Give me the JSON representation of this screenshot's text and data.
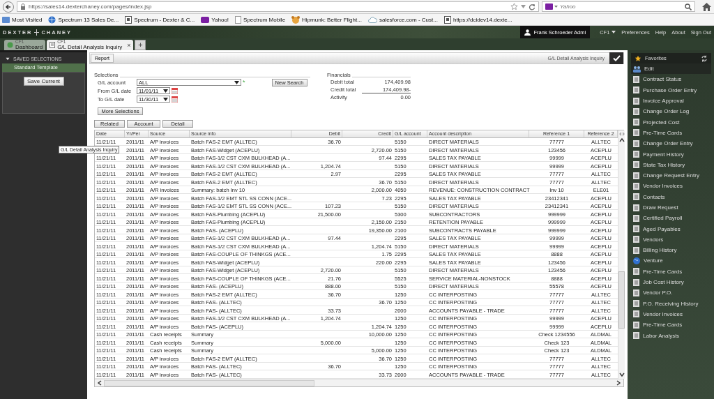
{
  "browser": {
    "url": "https://sales14.dexterchaney.com/pages/index.jsp",
    "search": {
      "placeholder": "Yahoo"
    }
  },
  "bookmarks": [
    {
      "label": "Most Visited",
      "kind": "folder"
    },
    {
      "label": "Spectrum 13 Sales De...",
      "kind": "globe"
    },
    {
      "label": "Spectrum - Dexter & C...",
      "kind": "page"
    },
    {
      "label": "Yahoo!",
      "kind": "yahoo"
    },
    {
      "label": "Spectrum Mobile",
      "kind": "blank"
    },
    {
      "label": "Hipmunk: Better Flight...",
      "kind": "animal"
    },
    {
      "label": "salesforce.com - Cust...",
      "kind": "cloud"
    },
    {
      "label": "https://dcidev14.dexte...",
      "kind": "page"
    }
  ],
  "app": {
    "logo": [
      "DEXTER",
      "CHANEY"
    ],
    "user": "Frank Schroeder Admi",
    "company": "CF1",
    "links": [
      "Preferences",
      "Help",
      "About",
      "Sign Out"
    ]
  },
  "tabs": [
    {
      "label": "Dashboard",
      "company": "CF1",
      "kind": "globe",
      "selected": false
    },
    {
      "label": "G/L Detail Analysis Inquiry",
      "company": "CF1",
      "kind": "doc",
      "selected": true,
      "close": "×"
    }
  ],
  "add_tab": "+",
  "saved_selections": {
    "title": "SAVED SELECTIONS",
    "expanded": true,
    "items": [
      {
        "label": "Standard Template",
        "selected": true
      }
    ],
    "button": "Save Current"
  },
  "toolbar": {
    "tab": "Report",
    "title": "G/L Detail Analysis Inquiry"
  },
  "selections": {
    "title": "Selections",
    "fields": [
      {
        "label": "G/L account",
        "value": "ALL",
        "kind": "account",
        "required": "*"
      },
      {
        "label": "From G/L date",
        "value": "11/01/11",
        "kind": "date"
      },
      {
        "label": "To G/L date",
        "value": "11/30/11",
        "kind": "date"
      }
    ],
    "new_search": "New Search",
    "more": "More Selections"
  },
  "financials": {
    "title": "Financials",
    "rows": [
      {
        "label": "Debit total",
        "value": "174,409.98"
      },
      {
        "label": "Credit total",
        "value": "174,409.98-"
      },
      {
        "label": "Activity",
        "value": "0.00"
      }
    ]
  },
  "actions": [
    "Related",
    "Account",
    "Detail"
  ],
  "table": {
    "columns": [
      "Date",
      "Yr/Per",
      "Source",
      "Source info",
      "Debit",
      "Credit",
      "G/L account",
      "Account description",
      "Reference 1",
      "Reference 2"
    ],
    "rows": [
      {
        "date": "11/21/11",
        "period": "2011/11",
        "source": "A/P invoices",
        "info": "Batch FAS-2 EMT (ALLTEC)",
        "debit": "36.70",
        "account": "5150",
        "description": "DIRECT MATERIALS",
        "ref1": "77777",
        "ref2": "ALLTEC"
      },
      {
        "period": "2011/11",
        "source": "A/P invoices",
        "info": "Batch FAS-Widget (ACEPLU)",
        "credit": "2,720.00",
        "account": "5150",
        "description": "DIRECT MATERIALS",
        "ref1": "123456",
        "ref2": "ACEPLU"
      },
      {
        "date": "11/21/11",
        "period": "2011/11",
        "source": "A/P invoices",
        "info": "Batch FAS-1/2 CST CXM BULKHEAD (A...",
        "credit": "97.44",
        "account": "2295",
        "description": "SALES TAX PAYABLE",
        "ref1": "99999",
        "ref2": "ACEPLU"
      },
      {
        "date": "11/21/11",
        "period": "2011/11",
        "source": "A/P invoices",
        "info": "Batch FAS-1/2 CST CXM BULKHEAD (A...",
        "debit": "1,204.74",
        "account": "5150",
        "description": "DIRECT MATERIALS",
        "ref1": "99999",
        "ref2": "ACEPLU"
      },
      {
        "date": "11/21/11",
        "period": "2011/11",
        "source": "A/P invoices",
        "info": "Batch FAS-2 EMT (ALLTEC)",
        "debit": "2.97",
        "account": "2295",
        "description": "SALES TAX PAYABLE",
        "ref1": "77777",
        "ref2": "ALLTEC"
      },
      {
        "date": "11/21/11",
        "period": "2011/11",
        "source": "A/P invoices",
        "info": "Batch FAS-2 EMT (ALLTEC)",
        "credit": "36.70",
        "account": "5150",
        "description": "DIRECT MATERIALS",
        "ref1": "77777",
        "ref2": "ALLTEC"
      },
      {
        "date": "11/21/11",
        "period": "2011/11",
        "source": "A/R invoices",
        "info": "Summary: batch Inv 10",
        "credit": "2,000.00",
        "account": "4050",
        "description": "REVENUE: CONSTRUCTION CONTRACT",
        "ref1": "Inv 10",
        "ref2": "ELE01"
      },
      {
        "date": "11/21/11",
        "period": "2011/11",
        "source": "A/P invoices",
        "info": "Batch FAS-1/2 EMT STL SS CONN (ACE...",
        "credit": "7.23",
        "account": "2295",
        "description": "SALES TAX PAYABLE",
        "ref1": "23412341",
        "ref2": "ACEPLU"
      },
      {
        "date": "11/21/11",
        "period": "2011/11",
        "source": "A/P invoices",
        "info": "Batch FAS-1/2 EMT STL SS CONN (ACE...",
        "debit": "107.23",
        "account": "5150",
        "description": "DIRECT MATERIALS",
        "ref1": "23412341",
        "ref2": "ACEPLU"
      },
      {
        "date": "11/21/11",
        "period": "2011/11",
        "source": "A/P invoices",
        "info": "Batch FAS-Plumbing (ACEPLU)",
        "debit": "21,500.00",
        "account": "5300",
        "description": "SUBCONTRACTORS",
        "ref1": "999999",
        "ref2": "ACEPLU"
      },
      {
        "date": "11/21/11",
        "period": "2011/11",
        "source": "A/P invoices",
        "info": "Batch FAS-Plumbing (ACEPLU)",
        "credit": "2,150.00",
        "account": "2150",
        "description": "RETENTION PAYABLE",
        "ref1": "999999",
        "ref2": "ACEPLU"
      },
      {
        "date": "11/21/11",
        "period": "2011/11",
        "source": "A/P invoices",
        "info": "Batch FAS- (ACEPLU)",
        "credit": "19,350.00",
        "account": "2100",
        "description": "SUBCONTRACTS PAYABLE",
        "ref1": "999999",
        "ref2": "ACEPLU"
      },
      {
        "date": "11/21/11",
        "period": "2011/11",
        "source": "A/P invoices",
        "info": "Batch FAS-1/2 CST CXM BULKHEAD (A...",
        "debit": "97.44",
        "account": "2295",
        "description": "SALES TAX PAYABLE",
        "ref1": "99999",
        "ref2": "ACEPLU"
      },
      {
        "date": "11/21/11",
        "period": "2011/11",
        "source": "A/P invoices",
        "info": "Batch FAS-1/2 CST CXM BULKHEAD (A...",
        "credit": "1,204.74",
        "account": "5150",
        "description": "DIRECT MATERIALS",
        "ref1": "99999",
        "ref2": "ACEPLU"
      },
      {
        "date": "11/21/11",
        "period": "2011/11",
        "source": "A/P invoices",
        "info": "Batch FAS-COUPLE OF THINKGS (ACE...",
        "credit": "1.75",
        "account": "2295",
        "description": "SALES TAX PAYABLE",
        "ref1": "8888",
        "ref2": "ACEPLU"
      },
      {
        "date": "11/21/11",
        "period": "2011/11",
        "source": "A/P invoices",
        "info": "Batch FAS-Widget (ACEPLU)",
        "credit": "220.00",
        "account": "2295",
        "description": "SALES TAX PAYABLE",
        "ref1": "123456",
        "ref2": "ACEPLU"
      },
      {
        "date": "11/21/11",
        "period": "2011/11",
        "source": "A/P invoices",
        "info": "Batch FAS-Widget (ACEPLU)",
        "debit": "2,720.00",
        "account": "5150",
        "description": "DIRECT MATERIALS",
        "ref1": "123456",
        "ref2": "ACEPLU"
      },
      {
        "date": "11/21/11",
        "period": "2011/11",
        "source": "A/P invoices",
        "info": "Batch FAS-COUPLE OF THINKGS (ACE...",
        "debit": "21.76",
        "account": "5525",
        "description": "SERVICE MATERIAL-NONSTOCK",
        "ref1": "8888",
        "ref2": "ACEPLU"
      },
      {
        "date": "11/21/11",
        "period": "2011/11",
        "source": "A/P invoices",
        "info": "Batch FAS- (ACEPLU)",
        "debit": "888.00",
        "account": "5150",
        "description": "DIRECT MATERIALS",
        "ref1": "55578",
        "ref2": "ACEPLU"
      },
      {
        "date": "11/21/11",
        "period": "2011/11",
        "source": "A/P invoices",
        "info": "Batch FAS-2 EMT (ALLTEC)",
        "debit": "36.70",
        "account": "1250",
        "description": "CC INTERPOSTING",
        "ref1": "77777",
        "ref2": "ALLTEC"
      },
      {
        "date": "11/21/11",
        "period": "2011/11",
        "source": "A/P invoices",
        "info": "Batch FAS- (ALLTEC)",
        "credit": "36.70",
        "account": "1250",
        "description": "CC INTERPOSTING",
        "ref1": "77777",
        "ref2": "ALLTEC"
      },
      {
        "date": "11/21/11",
        "period": "2011/11",
        "source": "A/P invoices",
        "info": "Batch FAS- (ALLTEC)",
        "debit": "33.73",
        "account": "2000",
        "description": "ACCOUNTS PAYABLE - TRADE",
        "ref1": "77777",
        "ref2": "ALLTEC"
      },
      {
        "date": "11/21/11",
        "period": "2011/11",
        "source": "A/P invoices",
        "info": "Batch FAS-1/2 CST CXM BULKHEAD (A...",
        "debit": "1,204.74",
        "account": "1250",
        "description": "CC INTERPOSTING",
        "ref1": "99999",
        "ref2": "ACEPLU"
      },
      {
        "date": "11/21/11",
        "period": "2011/11",
        "source": "A/P invoices",
        "info": "Batch FAS- (ACEPLU)",
        "credit": "1,204.74",
        "account": "1250",
        "description": "CC INTERPOSTING",
        "ref1": "99999",
        "ref2": "ACEPLU"
      },
      {
        "date": "11/21/11",
        "period": "2011/11",
        "source": "Cash receipts",
        "info": "Summary",
        "credit": "10,000.00",
        "account": "1250",
        "description": "CC INTERPOSTING",
        "ref1": "Check 1234556",
        "ref2": "ALDMAL"
      },
      {
        "date": "11/21/11",
        "period": "2011/11",
        "source": "Cash receipts",
        "info": "Summary",
        "debit": "5,000.00",
        "account": "1250",
        "description": "CC INTERPOSTING",
        "ref1": "Check 123",
        "ref2": "ALDMAL"
      },
      {
        "date": "11/21/11",
        "period": "2011/11",
        "source": "Cash receipts",
        "info": "Summary",
        "credit": "5,000.00",
        "account": "1250",
        "description": "CC INTERPOSTING",
        "ref1": "Check 123",
        "ref2": "ALDMAL"
      },
      {
        "date": "11/21/11",
        "period": "2011/11",
        "source": "A/P invoices",
        "info": "Batch FAS-2 EMT (ALLTEC)",
        "credit": "36.70",
        "account": "1250",
        "description": "CC INTERPOSTING",
        "ref1": "77777",
        "ref2": "ALLTEC"
      },
      {
        "date": "11/21/11",
        "period": "2011/11",
        "source": "A/P invoices",
        "info": "Batch FAS- (ALLTEC)",
        "debit": "36.70",
        "account": "1250",
        "description": "CC INTERPOSTING",
        "ref1": "77777",
        "ref2": "ALLTEC"
      },
      {
        "date": "11/21/11",
        "period": "2011/11",
        "source": "A/P invoices",
        "info": "Batch FAS- (ALLTEC)",
        "credit": "33.73",
        "account": "2000",
        "description": "ACCOUNTS PAYABLE - TRADE",
        "ref1": "77777",
        "ref2": "ALLTEC"
      }
    ]
  },
  "tooltip": "G/L Detail Analysis Inquiry",
  "favorites": {
    "title": "Favorites",
    "items": [
      {
        "label": "Edit",
        "kind": "edit"
      },
      {
        "label": "Contract Status",
        "kind": "doc"
      },
      {
        "label": "Purchase Order Entry",
        "kind": "doc"
      },
      {
        "label": "Invoice Approval",
        "kind": "doc"
      },
      {
        "label": "Change Order Log",
        "kind": "doc"
      },
      {
        "label": "Projected Cost",
        "kind": "doc"
      },
      {
        "label": "Pre-Time Cards",
        "kind": "doc"
      },
      {
        "label": "Change Order Entry",
        "kind": "doc"
      },
      {
        "label": "Payment History",
        "kind": "doc"
      },
      {
        "label": "State Tax History",
        "kind": "doc"
      },
      {
        "label": "Change Request Entry",
        "kind": "doc"
      },
      {
        "label": "Vendor Invoices",
        "kind": "doc"
      },
      {
        "label": "Contacts",
        "kind": "doc"
      },
      {
        "label": "Draw Request",
        "kind": "doc"
      },
      {
        "label": "Certified Payroll",
        "kind": "doc"
      },
      {
        "label": "Aged Payables",
        "kind": "doc"
      },
      {
        "label": "Vendors",
        "kind": "doc"
      },
      {
        "label": "Billing History",
        "kind": "doc"
      },
      {
        "label": "Venture",
        "kind": "globe"
      },
      {
        "label": "Pre-Time Cards",
        "kind": "doc"
      },
      {
        "label": "Job Cost History",
        "kind": "doc"
      },
      {
        "label": "Vendor P.O.",
        "kind": "doc"
      },
      {
        "label": "P.O. Receiving History",
        "kind": "doc"
      },
      {
        "label": "Vendor Invoices",
        "kind": "doc"
      },
      {
        "label": "Pre-Time Cards",
        "kind": "doc"
      },
      {
        "label": "Labor Analysis",
        "kind": "doc"
      }
    ]
  }
}
